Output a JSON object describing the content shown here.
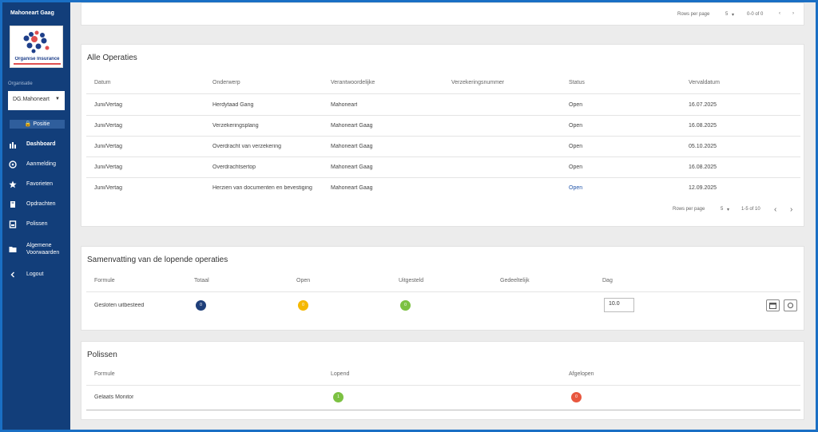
{
  "sidebar": {
    "brand": "Mahoneart Gaag",
    "logo_text": "Organise Insurance",
    "select_label": "Organisatie",
    "selected_org": "DG.Mahoneart",
    "positie_button": "Positie",
    "items": [
      {
        "label": "Dashboard",
        "icon": "home-icon",
        "bold": true
      },
      {
        "label": "Aanmelding",
        "icon": "globe-icon",
        "bold": false
      },
      {
        "label": "Favorieten",
        "icon": "star-icon",
        "bold": false
      },
      {
        "label": "Opdrachten",
        "icon": "book-icon",
        "bold": false
      },
      {
        "label": "Polissen",
        "icon": "document-icon",
        "bold": false
      },
      {
        "label": "Algemene Voorwaarden",
        "icon": "folder-icon",
        "bold": false
      },
      {
        "label": "Logout",
        "icon": "back-icon",
        "bold": false
      }
    ]
  },
  "top_pager": {
    "rows_per_page_label": "Rows per page",
    "rows_value": "5",
    "range_text": "0-0 of 0"
  },
  "operations": {
    "title": "Alle Operaties",
    "columns": [
      "Datum",
      "Onderwerp",
      "Verantwoordelijke",
      "Verzekeringsnummer",
      "Status",
      "Vervaldatum"
    ],
    "rows": [
      [
        "Juni/Vertag",
        "Herdytaad Gang",
        "Mahoneart",
        "",
        "Open",
        "16.07.2025"
      ],
      [
        "Juni/Vertag",
        "Verzekeringsplang",
        "Mahoneart Gaag",
        "",
        "Open",
        "16.08.2025"
      ],
      [
        "Juni/Vertag",
        "Overdracht van verzekering",
        "Mahoneart Gaag",
        "",
        "Open",
        "05.10.2025"
      ],
      [
        "Juni/Vertag",
        "Overdrachtsertop",
        "Mahoneart Gaag",
        "",
        "Open",
        "16.08.2025"
      ],
      [
        "Juni/Vertag",
        "Herzien van documenten en bevestiging",
        "Mahoneart Gaag",
        "",
        "Open",
        "12.09.2025"
      ]
    ],
    "pager": {
      "rows_per_page_label": "Rows per page",
      "rows_value": "5",
      "range_text": "1-5 of 10"
    }
  },
  "summary": {
    "title": "Samenvatting van de lopende operaties",
    "columns": [
      "Formule",
      "Totaal",
      "Open",
      "Uitgesteld",
      "Gedeeltelijk",
      "Dag"
    ],
    "row": {
      "formule": "Gesloten uitbesteed",
      "totaal": "0",
      "open": "0",
      "uitgesteld": "0",
      "gedeeltelijk": "",
      "dag": "10.0"
    }
  },
  "polissen": {
    "title": "Polissen",
    "columns": [
      "Formule",
      "Lopend",
      "Afgelopen"
    ],
    "row": {
      "formule": "Gelaats Monitor",
      "lopend": "1",
      "afgelopen": "0"
    }
  },
  "colors": {
    "sidebar": "#123e7a",
    "frame_border": "#1a6fc4",
    "navy": "#1f3f7a",
    "yellow": "#f5b800",
    "green": "#7cc142",
    "red": "#e8573f",
    "blue_text": "#2255aa"
  }
}
